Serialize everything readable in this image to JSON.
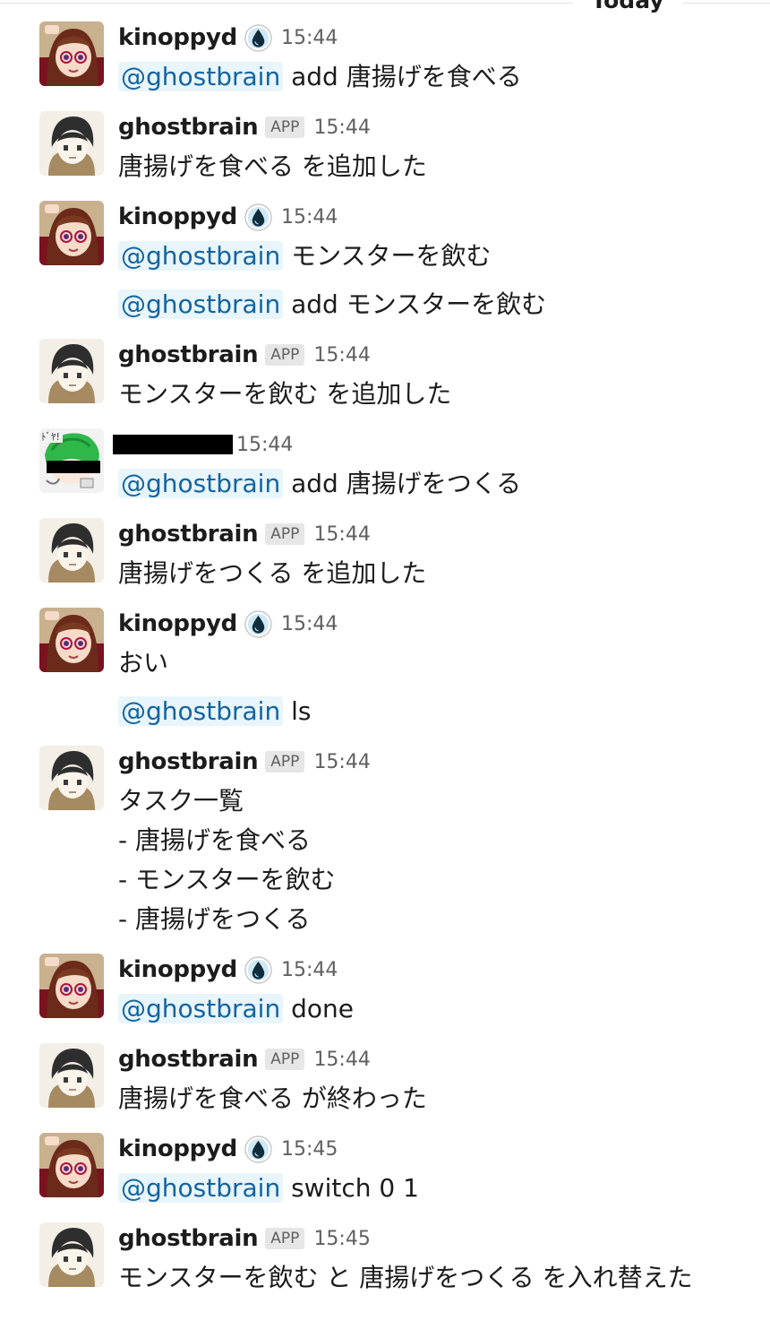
{
  "divider": {
    "label": "Today"
  },
  "users": {
    "kinoppyd": "kinoppyd",
    "ghostbrain": "ghostbrain",
    "app_badge": "APP"
  },
  "mention": "@ghostbrain",
  "messages": [
    {
      "time": "15:44",
      "text": "add 唐揚げを食べる"
    },
    {
      "time": "15:44",
      "text": "唐揚げを食べる を追加した"
    },
    {
      "time": "15:44",
      "text": "モンスターを飲む",
      "text2": "add モンスターを飲む"
    },
    {
      "time": "15:44",
      "text": "モンスターを飲む を追加した"
    },
    {
      "time": "15:44",
      "text": "add 唐揚げをつくる"
    },
    {
      "time": "15:44",
      "text": "唐揚げをつくる を追加した"
    },
    {
      "time": "15:44",
      "text": "おい",
      "text2": "ls"
    },
    {
      "time": "15:44",
      "lines": [
        "タスク一覧",
        "- 唐揚げを食べる",
        "- モンスターを飲む",
        "- 唐揚げをつくる"
      ]
    },
    {
      "time": "15:44",
      "text": "done"
    },
    {
      "time": "15:44",
      "text": "唐揚げを食べる が終わった"
    },
    {
      "time": "15:45",
      "text": "switch 0 1"
    },
    {
      "time": "15:45",
      "text": "モンスターを飲む と 唐揚げをつくる を入れ替えた"
    }
  ],
  "icons": {
    "status": "water-drop-icon",
    "avatar_kinoppyd": "kinoppyd-avatar",
    "avatar_ghostbrain": "ghostbrain-avatar",
    "avatar_redacted": "redacted-avatar"
  },
  "colors": {
    "mention_bg": "#e8f5fa",
    "mention_text": "#1264a3",
    "badge_bg": "#e6e6e6",
    "redaction": "#000000"
  }
}
